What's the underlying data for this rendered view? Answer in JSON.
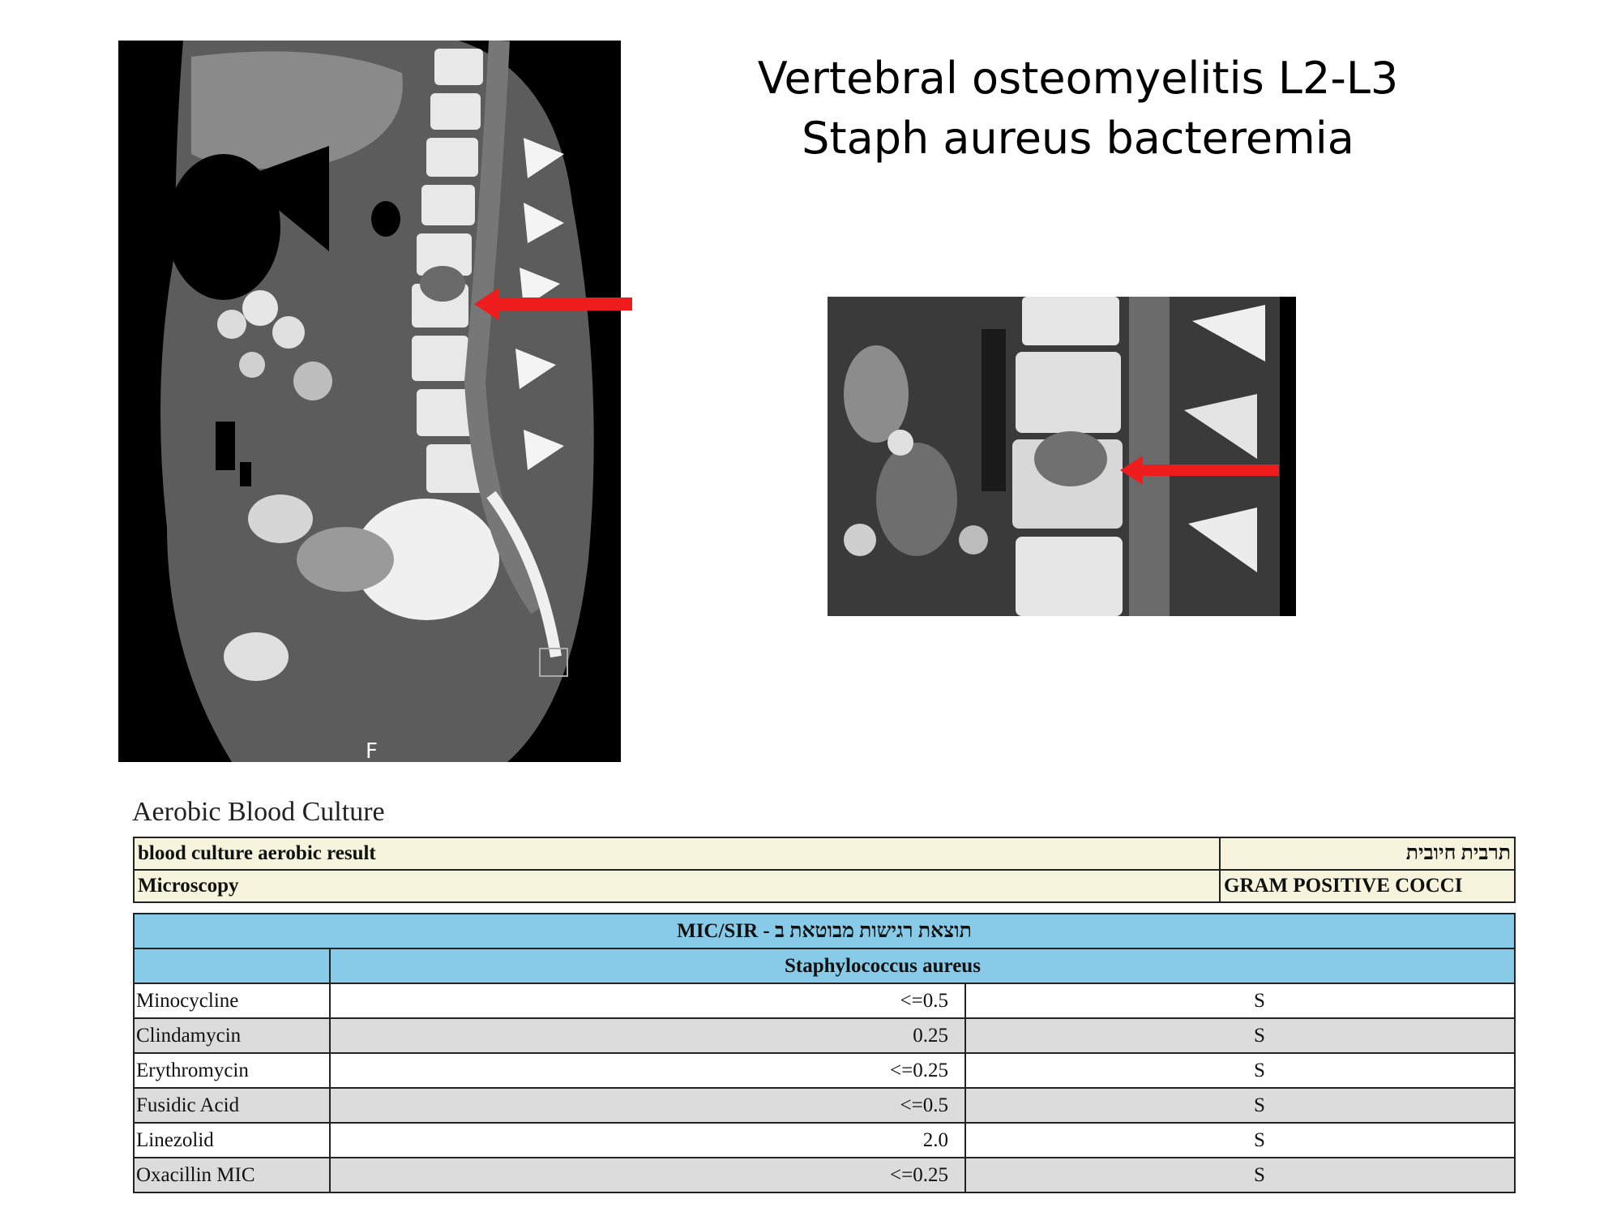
{
  "title": {
    "line1": "Vertebral osteomyelitis L2-L3",
    "line2": "Staph aureus bacteremia"
  },
  "images": {
    "sagittal_letter": "F",
    "arrow_color": "#ee1c1c"
  },
  "report": {
    "heading": "Aerobic Blood Culture",
    "summary": [
      {
        "label": "blood culture aerobic result",
        "value": "תרבית חיובית"
      },
      {
        "label": "Microscopy",
        "value": "GRAM POSITIVE COCCI"
      }
    ],
    "mic": {
      "title": "תוצאת רגישות מבוטאת ב - MIC/SIR",
      "organism": "Staphylococcus aureus",
      "rows": [
        {
          "drug": "Minocycline",
          "mic": "<=0.5",
          "sir": "S"
        },
        {
          "drug": "Clindamycin",
          "mic": "0.25",
          "sir": "S"
        },
        {
          "drug": "Erythromycin",
          "mic": "<=0.25",
          "sir": "S"
        },
        {
          "drug": "Fusidic Acid",
          "mic": "<=0.5",
          "sir": "S"
        },
        {
          "drug": "Linezolid",
          "mic": "2.0",
          "sir": "S"
        },
        {
          "drug": "Oxacillin MIC",
          "mic": "<=0.25",
          "sir": "S"
        }
      ]
    },
    "colors": {
      "header_blue": "#87cbe9",
      "summary_bg": "#f6f4dc",
      "alt_row": "#dcdcdc"
    }
  }
}
